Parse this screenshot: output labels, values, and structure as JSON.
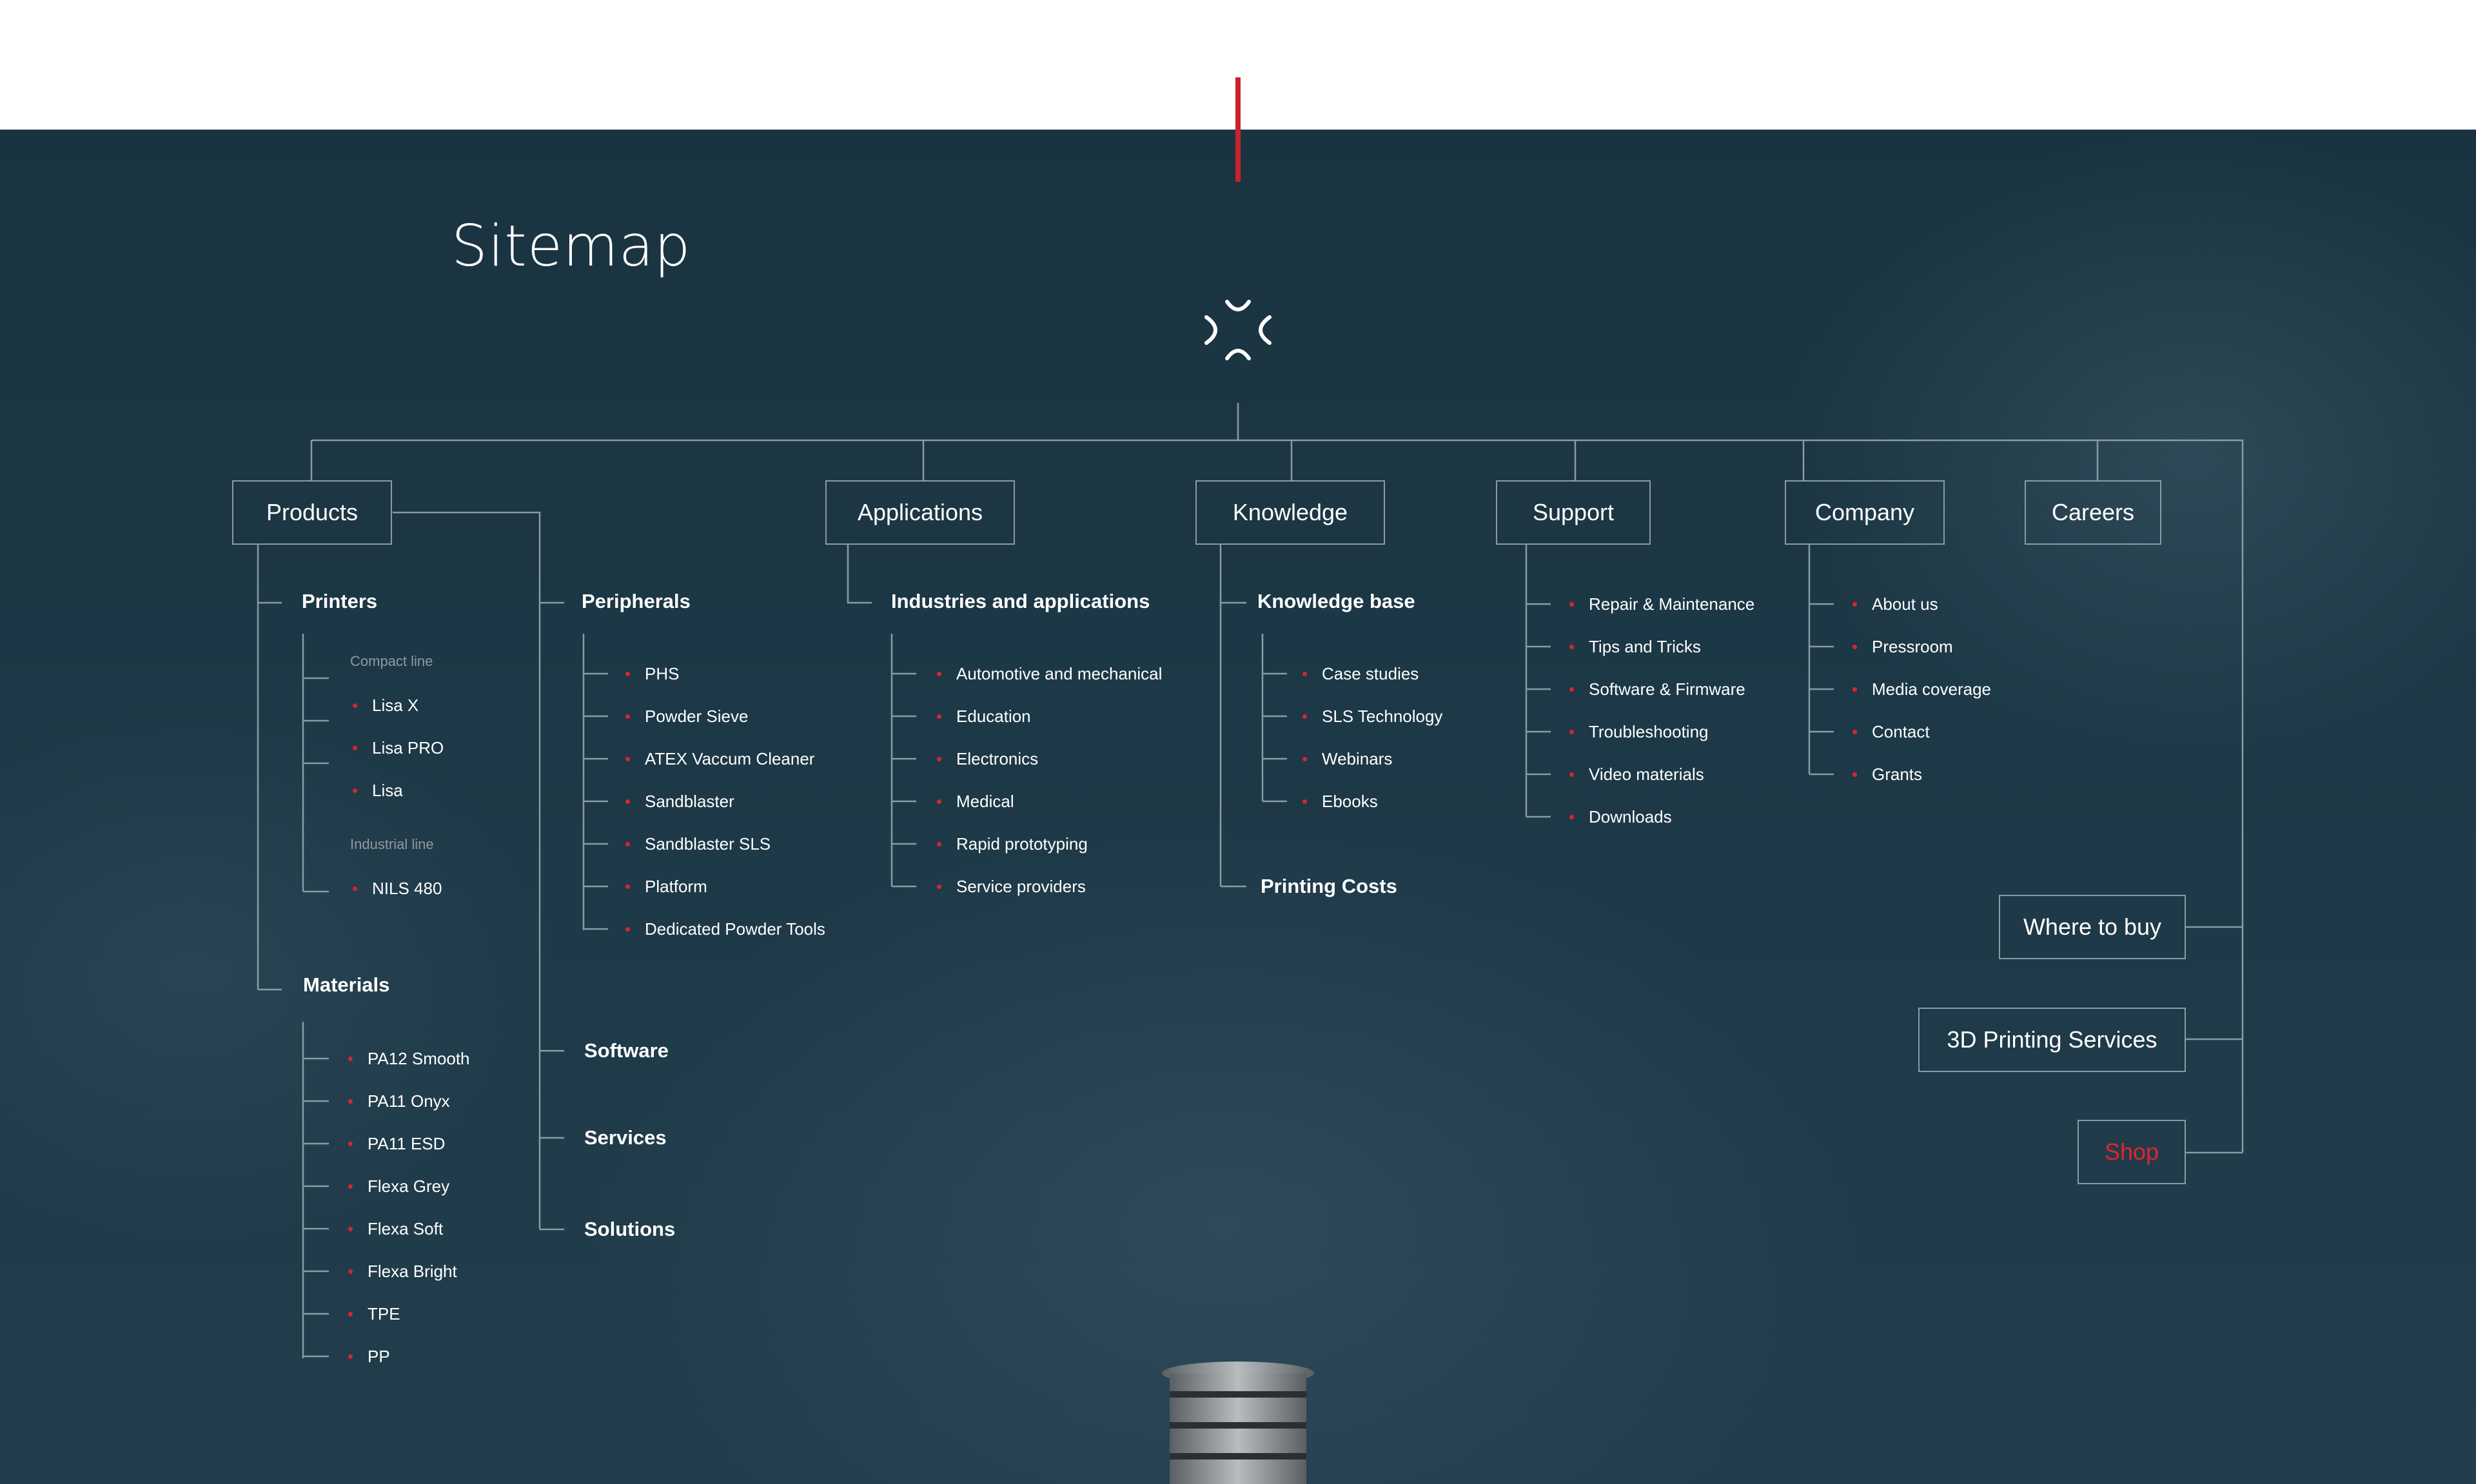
{
  "page": {
    "title": "Sitemap"
  },
  "colors": {
    "accent": "#c8232c",
    "background": "#1d3846",
    "line": "#8a9ba5"
  },
  "icons": {
    "logo": "sinterit-logo-icon",
    "bullet": "red-dot-bullet"
  },
  "nav": {
    "products": "Products",
    "applications": "Applications",
    "knowledge": "Knowledge",
    "support": "Support",
    "company": "Company",
    "careers": "Careers",
    "where_to_buy": "Where to buy",
    "printing_services": "3D Printing Services",
    "shop": "Shop"
  },
  "products": {
    "printers": {
      "label": "Printers",
      "compact_line": "Compact line",
      "compact_items": [
        "Lisa X",
        "Lisa PRO",
        "Lisa"
      ],
      "industrial_line": "Industrial line",
      "industrial_items": [
        "NILS 480"
      ]
    },
    "materials": {
      "label": "Materials",
      "items": [
        "PA12 Smooth",
        "PA11 Onyx",
        "PA11 ESD",
        "Flexa Grey",
        "Flexa Soft",
        "Flexa Bright",
        "TPE",
        "PP"
      ]
    },
    "peripherals": {
      "label": "Peripherals",
      "items": [
        "PHS",
        "Powder Sieve",
        "ATEX Vaccum Cleaner",
        "Sandblaster",
        "Sandblaster SLS",
        "Platform",
        "Dedicated Powder Tools"
      ]
    },
    "software": "Software",
    "services": "Services",
    "solutions": "Solutions"
  },
  "applications": {
    "industries": {
      "label": "Industries and applications",
      "items": [
        "Automotive and mechanical",
        "Education",
        "Electronics",
        "Medical",
        "Rapid prototyping",
        "Service providers"
      ]
    }
  },
  "knowledge": {
    "base": {
      "label": "Knowledge base",
      "items": [
        "Case studies",
        "SLS Technology",
        "Webinars",
        "Ebooks"
      ]
    },
    "printing_costs": "Printing Costs"
  },
  "support": {
    "items": [
      "Repair & Maintenance",
      "Tips and Tricks",
      "Software & Firmware",
      "Troubleshooting",
      "Video materials",
      "Downloads"
    ]
  },
  "company": {
    "items": [
      "About us",
      "Pressroom",
      "Media coverage",
      "Contact",
      "Grants"
    ]
  }
}
